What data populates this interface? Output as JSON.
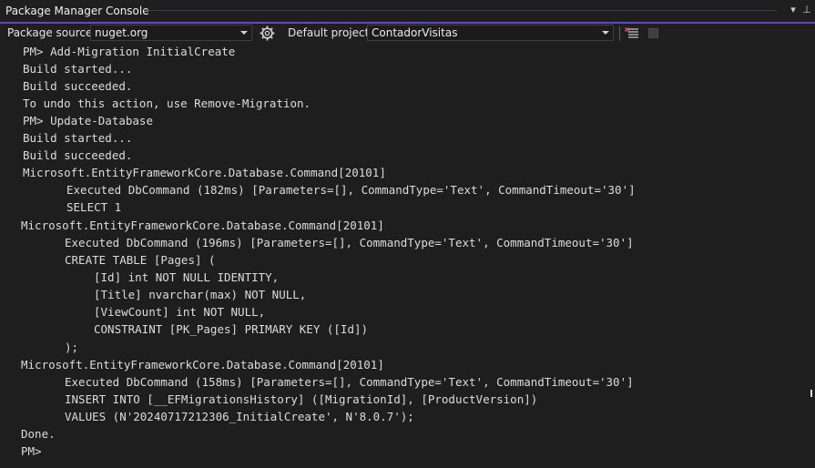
{
  "window": {
    "title": "Package Manager Console",
    "pin_glyph": "▾",
    "pin_glyph2": "⊥"
  },
  "toolbar": {
    "package_source_label": "Package source:",
    "package_source_value": "nuget.org",
    "settings_icon": "gear-icon",
    "default_project_label": "Default project:",
    "default_project_value": "ContadorVisitas",
    "clear_icon": "clear-console-icon",
    "stop_icon": "stop-icon"
  },
  "colors": {
    "accent": "#6b44c5",
    "background": "#1e1e1e",
    "text": "#dcdcdc"
  },
  "console": {
    "lines": [
      "PM> Add-Migration InitialCreate",
      "Build started...",
      "Build succeeded.",
      "To undo this action, use Remove-Migration.",
      "PM> Update-Database",
      "Build started...",
      "Build succeeded.",
      "Microsoft.EntityFrameworkCore.Database.Command[20101]",
      "Executed DbCommand (182ms) [Parameters=[], CommandType='Text', CommandTimeout='30']",
      "SELECT 1",
      "Microsoft.EntityFrameworkCore.Database.Command[20101]",
      "Executed DbCommand (196ms) [Parameters=[], CommandType='Text', CommandTimeout='30']",
      "CREATE TABLE [Pages] (",
      "[Id] int NOT NULL IDENTITY,",
      "[Title] nvarchar(max) NOT NULL,",
      "[ViewCount] int NOT NULL,",
      "CONSTRAINT [PK_Pages] PRIMARY KEY ([Id])",
      ");",
      "Microsoft.EntityFrameworkCore.Database.Command[20101]",
      "Executed DbCommand (158ms) [Parameters=[], CommandType='Text', CommandTimeout='30']",
      "INSERT INTO [__EFMigrationsHistory] ([MigrationId], [ProductVersion])",
      "VALUES (N'20240717212306_InitialCreate', N'8.0.7');",
      "Done.",
      "PM>"
    ]
  }
}
